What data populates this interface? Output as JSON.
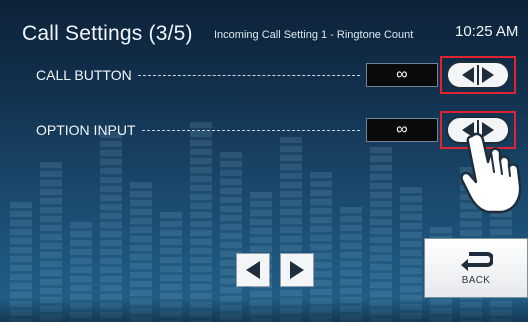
{
  "header": {
    "title": "Call Settings (3/5)",
    "subtitle": "Incoming Call Setting 1 - Ringtone Count",
    "time": "10:25 AM"
  },
  "settings": [
    {
      "label": "CALL BUTTON",
      "value": "∞"
    },
    {
      "label": "OPTION INPUT",
      "value": "∞"
    }
  ],
  "footer": {
    "back_label": "BACK"
  },
  "colors": {
    "highlight": "#e0242f",
    "value_box": "#0a0a0a",
    "background_top": "#0d2238",
    "background_bottom": "#23618a"
  },
  "icons": {
    "stepper": "left-right-arrow-icon",
    "pointer": "pointing-hand-icon",
    "back": "return-arrow-icon",
    "prev_page": "triangle-left-icon",
    "next_page": "triangle-right-icon"
  }
}
